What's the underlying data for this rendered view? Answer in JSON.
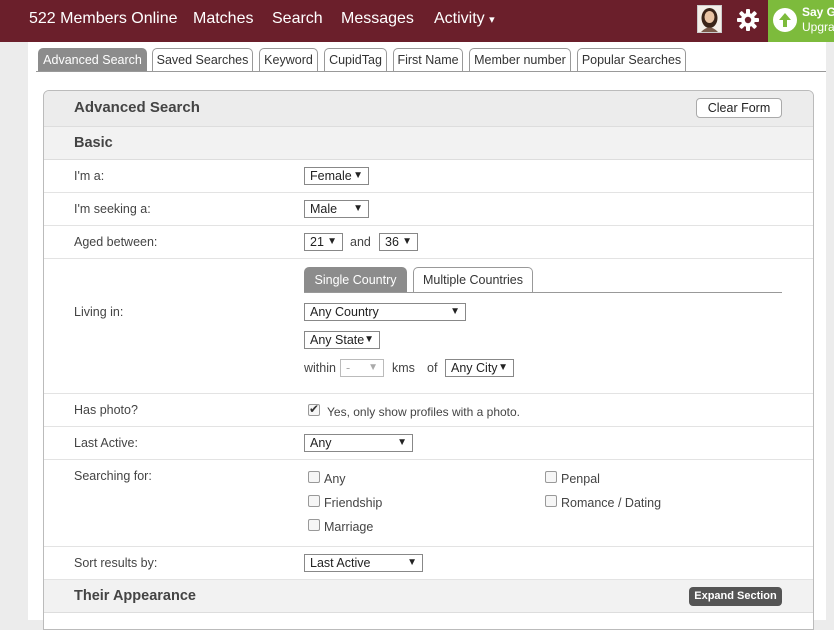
{
  "nav": {
    "members_online": "522 Members Online",
    "matches": "Matches",
    "search": "Search",
    "messages": "Messages",
    "activity": "Activity",
    "activity_caret": "▾",
    "upgrade_line1": "Say G",
    "upgrade_line2": "Upgra"
  },
  "tabs": [
    {
      "label": "Advanced Search",
      "active": true
    },
    {
      "label": "Saved Searches"
    },
    {
      "label": "Keyword"
    },
    {
      "label": "CupidTag"
    },
    {
      "label": "First Name"
    },
    {
      "label": "Member number"
    },
    {
      "label": "Popular Searches"
    }
  ],
  "panel": {
    "title": "Advanced Search",
    "clear_button": "Clear Form"
  },
  "basic": {
    "heading": "Basic",
    "im_a_label": "I'm a:",
    "im_a_value": "Female",
    "seeking_label": "I'm seeking a:",
    "seeking_value": "Male",
    "aged_label": "Aged between:",
    "age_min": "21",
    "age_and": "and",
    "age_max": "36",
    "living_label": "Living in:",
    "single_country_tab": "Single Country",
    "multiple_countries_tab": "Multiple Countries",
    "country_value": "Any Country",
    "state_value": "Any State",
    "within_label": "within",
    "within_value": "-",
    "kms_label": "kms",
    "of_label": "of",
    "city_value": "Any City",
    "has_photo_label": "Has photo?",
    "has_photo_text": "Yes, only show profiles with a photo.",
    "has_photo_checked": true,
    "last_active_label": "Last Active:",
    "last_active_value": "Any",
    "searching_for_label": "Searching for:",
    "searching_options": {
      "any": "Any",
      "friendship": "Friendship",
      "marriage": "Marriage",
      "penpal": "Penpal",
      "romance": "Romance / Dating"
    },
    "sort_label": "Sort results by:",
    "sort_value": "Last Active",
    "caret": "▼"
  },
  "appearance": {
    "heading": "Their Appearance",
    "expand_button": "Expand Section"
  }
}
